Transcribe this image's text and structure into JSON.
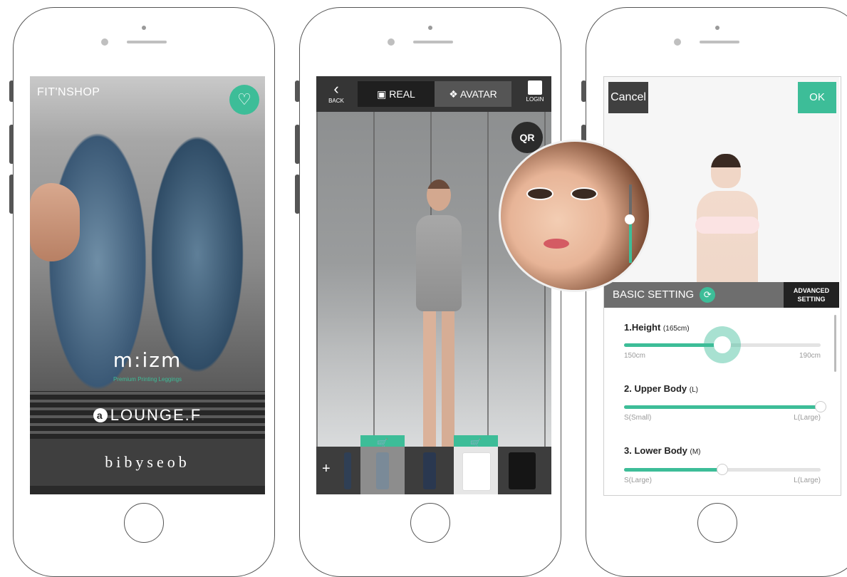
{
  "phone1": {
    "brand": "FIT'NSHOP",
    "hero_logo": "m:izm",
    "hero_tagline": "Premium Printing Leggings",
    "brands": [
      "LOUNGE.F",
      "bibyseob"
    ]
  },
  "phone2": {
    "back_label": "BACK",
    "tab_real": "REAL",
    "tab_avatar": "AVATAR",
    "login_label": "LOGIN",
    "qr_label": "QR",
    "add_label": "+"
  },
  "phone3": {
    "cancel_label": "Cancel",
    "ok_label": "OK",
    "basic_setting": "BASIC SETTING",
    "advanced_setting_line1": "ADVANCED",
    "advanced_setting_line2": "SETTING",
    "sliders": [
      {
        "label": "1.Height",
        "value": "(165cm)",
        "min": "150cm",
        "max": "190cm",
        "level": 0.5
      },
      {
        "label": "2. Upper Body",
        "value": "(L)",
        "min": "S(Small)",
        "max": "L(Large)",
        "level": 1.0
      },
      {
        "label": "3. Lower Body",
        "value": "(M)",
        "min": "S(Large)",
        "max": "L(Large)",
        "level": 0.5
      }
    ]
  },
  "colors": {
    "accent": "#3dbd98",
    "dark": "#353535"
  }
}
